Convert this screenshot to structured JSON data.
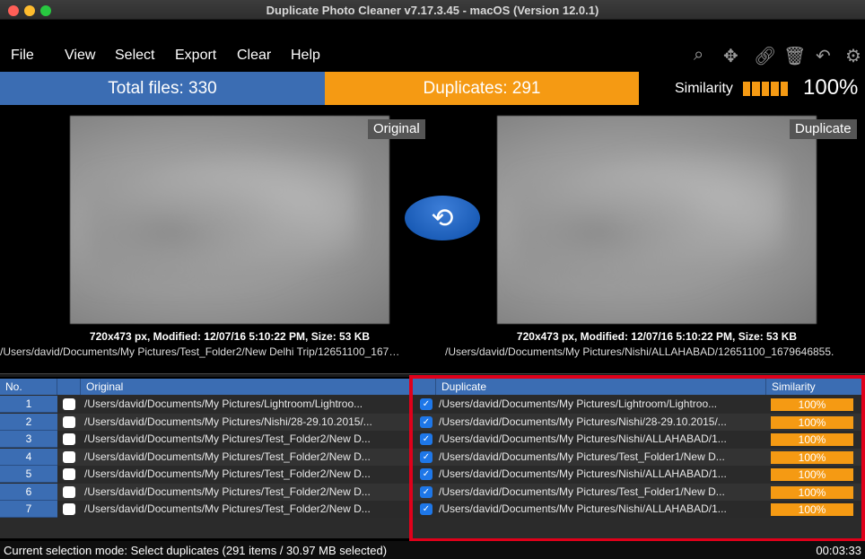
{
  "window": {
    "title": "Duplicate Photo Cleaner v7.17.3.45 - macOS (Version 12.0.1)"
  },
  "menu": {
    "items": [
      "File",
      "View",
      "Select",
      "Export",
      "Clear",
      "Help"
    ]
  },
  "toolbar": {
    "icons": [
      "search-icon",
      "move-icon",
      "link-icon",
      "trash-icon",
      "undo-icon",
      "gear-icon"
    ]
  },
  "stats": {
    "total": "Total files: 330",
    "duplicates": "Duplicates: 291",
    "similarity_label": "Similarity",
    "similarity_value": "100%",
    "similarity_level": 1.0
  },
  "colors": {
    "accent_blue": "#3b6db3",
    "accent_orange": "#f59a13",
    "highlight_red": "#e0001a"
  },
  "preview": {
    "original_tag": "Original",
    "duplicate_tag": "Duplicate",
    "original_info": "720x473 px, Modified: 12/07/16 5:10:22 PM, Size: 53 KB",
    "duplicate_info": "720x473 px, Modified: 12/07/16 5:10:22 PM, Size: 53 KB",
    "original_path": "/Users/david/Documents/My Pictures/Test_Folder2/New Delhi Trip/12651100_167…",
    "duplicate_path": "/Users/david/Documents/My Pictures/Nishi/ALLAHABAD/12651100_1679646855."
  },
  "table": {
    "headers": {
      "no": "No.",
      "original": "Original",
      "duplicate": "Duplicate",
      "similarity": "Similarity"
    },
    "rows": [
      {
        "no": "1",
        "original": "/Users/david/Documents/My Pictures/Lightroom/Lightroo...",
        "duplicate": "/Users/david/Documents/My Pictures/Lightroom/Lightroo...",
        "similarity": "100%"
      },
      {
        "no": "2",
        "original": "/Users/david/Documents/My Pictures/Nishi/28-29.10.2015/...",
        "duplicate": "/Users/david/Documents/My Pictures/Nishi/28-29.10.2015/...",
        "similarity": "100%"
      },
      {
        "no": "3",
        "original": "/Users/david/Documents/My Pictures/Test_Folder2/New D...",
        "duplicate": "/Users/david/Documents/My Pictures/Nishi/ALLAHABAD/1...",
        "similarity": "100%"
      },
      {
        "no": "4",
        "original": "/Users/david/Documents/My Pictures/Test_Folder2/New D...",
        "duplicate": "/Users/david/Documents/My Pictures/Test_Folder1/New D...",
        "similarity": "100%"
      },
      {
        "no": "5",
        "original": "/Users/david/Documents/My Pictures/Test_Folder2/New D...",
        "duplicate": "/Users/david/Documents/My Pictures/Nishi/ALLAHABAD/1...",
        "similarity": "100%"
      },
      {
        "no": "6",
        "original": "/Users/david/Documents/My Pictures/Test_Folder2/New D...",
        "duplicate": "/Users/david/Documents/My Pictures/Test_Folder1/New D...",
        "similarity": "100%"
      },
      {
        "no": "7",
        "original": "/Users/david/Documents/Mv Pictures/Test_Folder2/New D...",
        "duplicate": "/Users/david/Documents/Mv Pictures/Nishi/ALLAHABAD/1...",
        "similarity": "100%"
      }
    ]
  },
  "status": {
    "selection": "Current selection mode: Select duplicates (291 items / 30.97 MB selected)",
    "elapsed": "00:03:33"
  }
}
